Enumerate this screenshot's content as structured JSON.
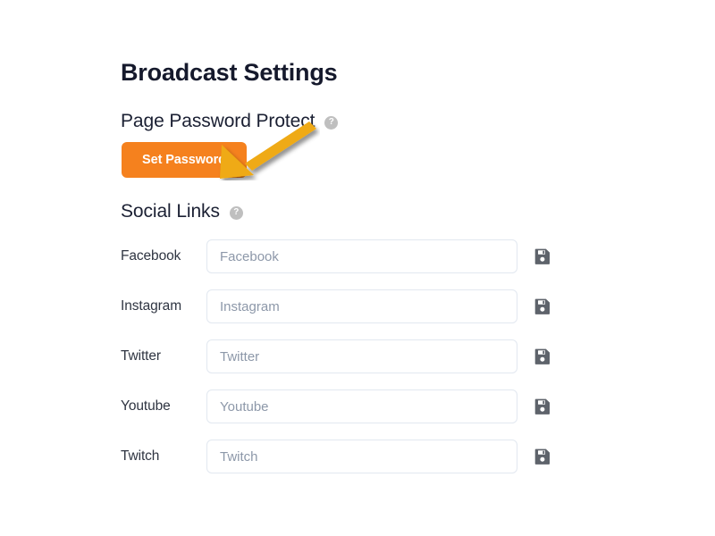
{
  "page": {
    "title": "Broadcast Settings",
    "background_color": "#ffffff"
  },
  "colors": {
    "title_text": "#15192c",
    "heading_text": "#1b2033",
    "button_orange": "#f5811e",
    "arrow_gold": "#efaa12",
    "input_border": "#e2e8f0",
    "placeholder_text": "#8d98a9",
    "label_text": "#2f3542",
    "help_icon_background": "#bfbfbf",
    "save_icon": "#5e636b"
  },
  "password_section": {
    "heading": "Page Password Protect",
    "help_icon": "question-mark-circle-icon",
    "help_icon_glyph": "?",
    "button_label": "Set Password"
  },
  "annotation": {
    "arrow": "arrow-pointer-icon",
    "points_at": "Set Password"
  },
  "social_section": {
    "heading": "Social Links",
    "help_icon": "question-mark-circle-icon",
    "help_icon_glyph": "?",
    "save_icon": "floppy-disk-save-icon",
    "rows": [
      {
        "label": "Facebook",
        "value": "",
        "placeholder": "Facebook"
      },
      {
        "label": "Instagram",
        "value": "",
        "placeholder": "Instagram"
      },
      {
        "label": "Twitter",
        "value": "",
        "placeholder": "Twitter"
      },
      {
        "label": "Youtube",
        "value": "",
        "placeholder": "Youtube"
      },
      {
        "label": "Twitch",
        "value": "",
        "placeholder": "Twitch"
      }
    ]
  }
}
